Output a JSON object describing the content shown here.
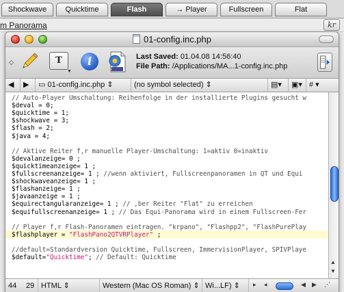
{
  "top_tabs": [
    "Shockwave",
    "Quicktime",
    "Flash",
    "→ Player",
    "Fullscreen",
    "Flat"
  ],
  "background_link": "m Panorama",
  "kr_label": "kr",
  "window": {
    "title": "01-config.inc.php",
    "last_saved_label": "Last Saved:",
    "last_saved_value": "01.04.08 14:56:40",
    "file_path_label": "File Path:",
    "file_path_value": "/Applications/MA...1-config.inc.php",
    "text_button_label": "T"
  },
  "navbar": {
    "filename": "01-config.inc.php",
    "symbol": "(no symbol selected)",
    "hash": "#"
  },
  "code_lines": [
    [
      {
        "t": "// Auto-Player Umschaltung: Reihenfolge in der installierte Plugins gesucht w",
        "c": "c-comment"
      }
    ],
    [
      {
        "t": "$deval = 0;"
      }
    ],
    [
      {
        "t": "$quicktime = 1;"
      }
    ],
    [
      {
        "t": "$shockwave = 3;"
      }
    ],
    [
      {
        "t": "$flash = 2;"
      }
    ],
    [
      {
        "t": "$java = 4;"
      }
    ],
    [
      {
        "t": ""
      }
    ],
    [
      {
        "t": "// Aktive Reiter f,r manuelle Player-Umschaltung: 1=aktiv 0=inaktiv",
        "c": "c-comment"
      }
    ],
    [
      {
        "t": "$devalanzeige= 0 ;"
      }
    ],
    [
      {
        "t": "$quicktimeanzeige= 1 ;"
      }
    ],
    [
      {
        "t": "$fullscreenanzeige= 1 ; "
      },
      {
        "t": "//wenn aktiviert, Fullscreenpanoramen in QT und Equi",
        "c": "c-comment"
      }
    ],
    [
      {
        "t": "$shockwaveanzeige= 1 ;"
      }
    ],
    [
      {
        "t": "$flashanzeige= 1 ;"
      }
    ],
    [
      {
        "t": "$javaanzeige = 1 ;"
      }
    ],
    [
      {
        "t": "$equirectangularanzeige= 1 ; "
      },
      {
        "t": "// ,ber Reiter \"Flat\" zu erreichen",
        "c": "c-comment"
      }
    ],
    [
      {
        "t": "$equifullscreenanzeige= 1 ; "
      },
      {
        "t": "// Das Equi-Panorama wird in einem Fullscreen-Fer",
        "c": "c-comment"
      }
    ],
    [
      {
        "t": ""
      }
    ],
    [
      {
        "t": "// Player f,r Flash-Panoramen eintragen. \"krpano\", \"Flashpp2\", \"FlashPurePlay",
        "c": "c-comment"
      }
    ],
    [
      {
        "t": "$flashplayer = "
      },
      {
        "t": "\"FlashPano2QTVRPlayer\"",
        "c": "c-string"
      },
      {
        "t": " ;"
      }
    ],
    [
      {
        "t": ""
      }
    ],
    [
      {
        "t": "//default=Standardversion Quicktime, Fullscreen, ImmervisionPlayer, SPIVPlaye",
        "c": "c-comment"
      }
    ],
    [
      {
        "t": "$default="
      },
      {
        "t": "\"Quicktime\"",
        "c": "c-string"
      },
      {
        "t": "; "
      },
      {
        "t": "// Default: Quicktime",
        "c": "c-comment"
      }
    ]
  ],
  "highlight_line": 18,
  "status": {
    "line": "44",
    "column": "29",
    "language": "HTML",
    "encoding": "Western (Mac OS Roman)",
    "line_endings": "Wi...LF)"
  },
  "colors": {
    "active_tab": "#5a5a5a",
    "comment": "#4d4d4d",
    "string": "#c4127a",
    "highlight": "#fffbd0",
    "scroll_thumb": "#2a6fd8"
  }
}
